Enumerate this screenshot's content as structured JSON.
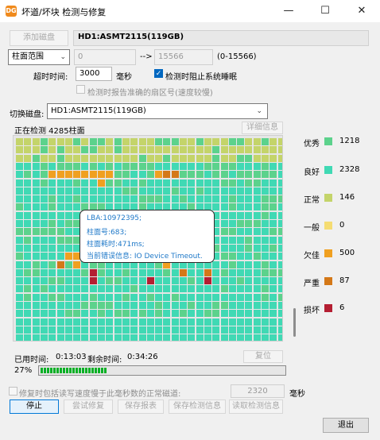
{
  "window": {
    "title": "坏道/坏块 检测与修复",
    "app_icon": "DG",
    "controls": {
      "minimize": "—",
      "maximize": "☐",
      "close": "✕"
    }
  },
  "top": {
    "add_disk_label": "添加磁盘",
    "disk_name": "HD1:ASMT2115(119GB)",
    "range_select": "柱面范围",
    "range_from": "0",
    "range_arrow": "-->",
    "range_to": "15566",
    "range_hint": "(0-15566)",
    "timeout_label": "超时时间:",
    "timeout_value": "3000",
    "timeout_unit": "毫秒",
    "block_system_sleep": "检测时阻止系统睡眠",
    "report_exact_sector": "检测时报告准确的扇区号(速度较慢)"
  },
  "switch_disk": {
    "label": "切换磁盘:",
    "value": "HD1:ASMT2115(119GB)"
  },
  "scan": {
    "status": "正在检测 4285柱面",
    "details_button": "详细信息"
  },
  "colors": {
    "excellent": "#5cd28c",
    "good": "#40d9b4",
    "normal": "#c4d46a",
    "fair": "#f5dc72",
    "poor": "#f0a020",
    "severe": "#d47818",
    "damaged": "#b41e32",
    "unscanned": "#f4f4f4"
  },
  "legend": [
    {
      "label": "优秀",
      "value": "1218",
      "color": "#5cd28c"
    },
    {
      "label": "良好",
      "value": "2328",
      "color": "#40d9b4"
    },
    {
      "label": "正常",
      "value": "146",
      "color": "#c4d46a"
    },
    {
      "label": "一般",
      "value": "0",
      "color": "#f5dc72"
    },
    {
      "label": "欠佳",
      "value": "500",
      "color": "#f0a020"
    },
    {
      "label": "严重",
      "value": "87",
      "color": "#d47818"
    },
    {
      "label": "损坏",
      "value": "6",
      "color": "#b41e32"
    }
  ],
  "tooltip": {
    "lba": "LBA:10972395;",
    "cylinder": "柱面号:683;",
    "time": "柱面耗时:471ms;",
    "error": "当前错误信息: IO Device Timeout."
  },
  "timing": {
    "elapsed_label": "已用时间:",
    "elapsed": "0:13:03",
    "remaining_label": "剩余时间:",
    "remaining": "0:34:26",
    "reset_button": "复位"
  },
  "progress": {
    "percent_text": "27%",
    "fraction": 0.27
  },
  "repair": {
    "option_label": "修复时包括读写速度慢于此毫秒数的正常磁道:",
    "threshold": "2320",
    "threshold_unit": "毫秒"
  },
  "actions": {
    "stop": "停止",
    "try_repair": "尝试修复",
    "save_report": "保存报表",
    "save_scan_info": "保存检测信息",
    "load_scan_info": "读取检测信息",
    "exit": "退出"
  }
}
